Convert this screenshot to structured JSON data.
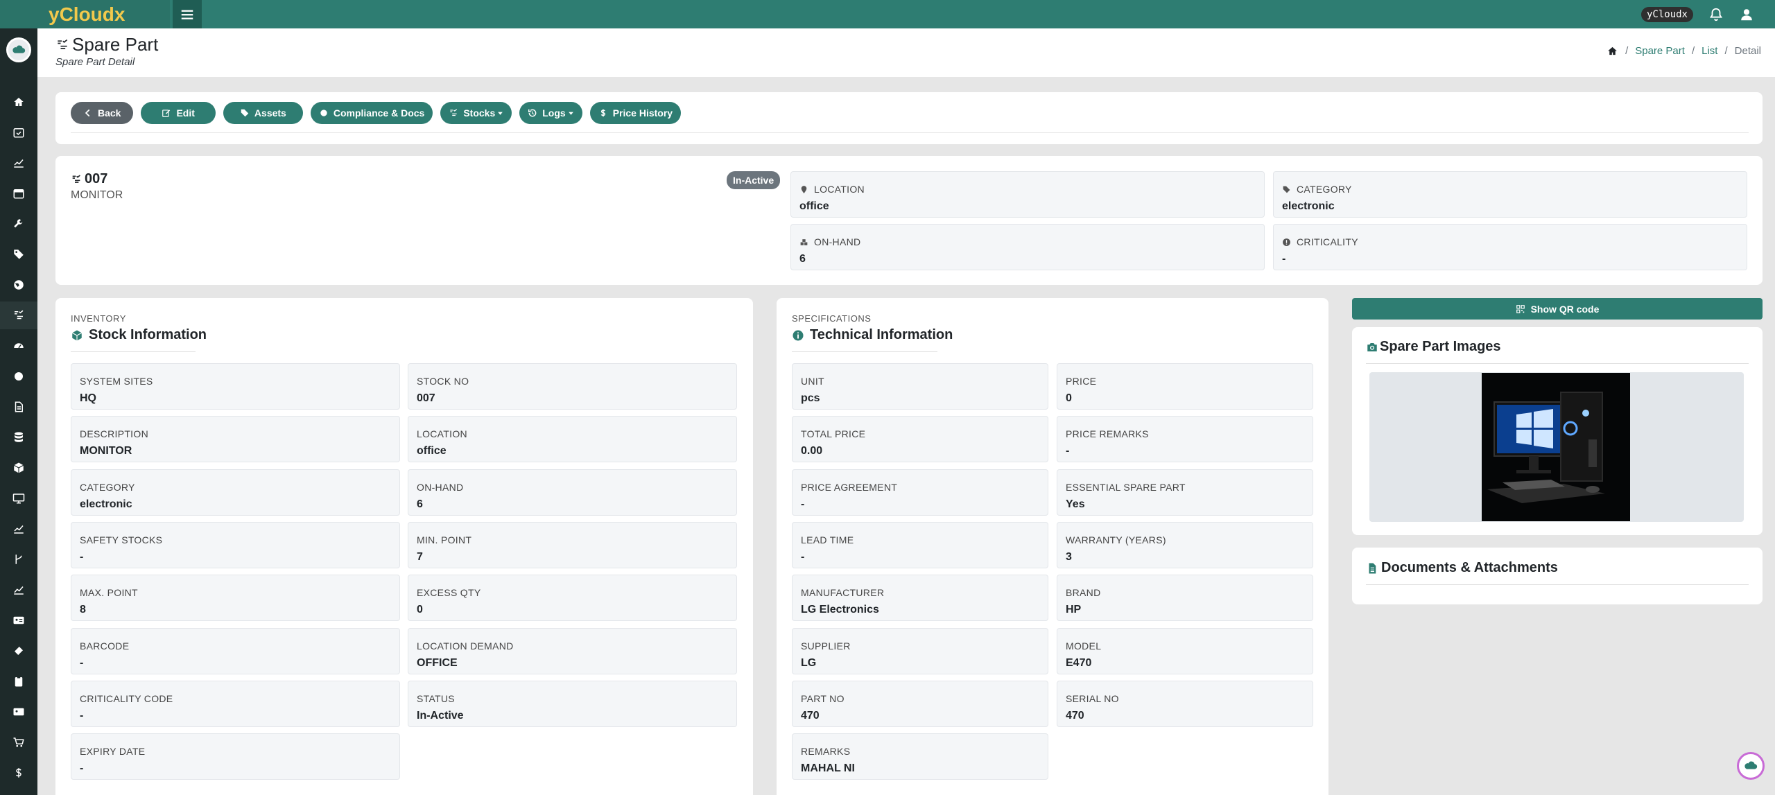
{
  "app": {
    "brand": "yCloudx",
    "user_chip": "yCloudx"
  },
  "sidebar": {
    "items": [
      {
        "icon": "home-icon"
      },
      {
        "icon": "calendar-check-icon"
      },
      {
        "icon": "chart-line-icon"
      },
      {
        "icon": "calendar-icon"
      },
      {
        "icon": "wrench-icon"
      },
      {
        "icon": "tag-icon"
      },
      {
        "icon": "globe-icon"
      },
      {
        "icon": "spare-part-icon"
      },
      {
        "icon": "dashboard-icon"
      },
      {
        "icon": "circle-icon"
      },
      {
        "icon": "document-icon"
      },
      {
        "icon": "database-icon"
      },
      {
        "icon": "box-icon"
      },
      {
        "icon": "monitor-icon"
      },
      {
        "icon": "chart-line-icon"
      },
      {
        "icon": "branch-icon"
      },
      {
        "icon": "chart-area-icon"
      },
      {
        "icon": "id-card-icon"
      },
      {
        "icon": "ticket-icon"
      },
      {
        "icon": "clipboard-icon"
      },
      {
        "icon": "contact-card-icon"
      },
      {
        "icon": "cart-icon"
      },
      {
        "icon": "dollar-icon"
      }
    ]
  },
  "header": {
    "title": "Spare Part",
    "subtitle": "Spare Part Detail",
    "breadcrumb": [
      "Spare Part",
      "List",
      "Detail"
    ]
  },
  "actions": {
    "back": "Back",
    "edit": "Edit",
    "assets": "Assets",
    "compliance": "Compliance & Docs",
    "stocks": "Stocks",
    "logs": "Logs",
    "price_history": "Price History"
  },
  "summary": {
    "id": "007",
    "description": "MONITOR",
    "status": "In-Active",
    "fields": {
      "location": {
        "label": "LOCATION",
        "value": "office"
      },
      "category": {
        "label": "CATEGORY",
        "value": "electronic"
      },
      "on_hand": {
        "label": "ON-HAND",
        "value": "6"
      },
      "criticality": {
        "label": "CRITICALITY",
        "value": "-"
      }
    }
  },
  "inventory": {
    "overline": "INVENTORY",
    "title": "Stock Information",
    "fields": [
      {
        "label": "SYSTEM SITES",
        "value": "HQ"
      },
      {
        "label": "STOCK NO",
        "value": "007"
      },
      {
        "label": "DESCRIPTION",
        "value": "MONITOR"
      },
      {
        "label": "LOCATION",
        "value": "office"
      },
      {
        "label": "CATEGORY",
        "value": "electronic"
      },
      {
        "label": "ON-HAND",
        "value": "6"
      },
      {
        "label": "SAFETY STOCKS",
        "value": "-"
      },
      {
        "label": "MIN. POINT",
        "value": "7"
      },
      {
        "label": "MAX. POINT",
        "value": "8"
      },
      {
        "label": "EXCESS QTY",
        "value": "0"
      },
      {
        "label": "BARCODE",
        "value": "-"
      },
      {
        "label": "LOCATION DEMAND",
        "value": "OFFICE"
      },
      {
        "label": "CRITICALITY CODE",
        "value": "-"
      },
      {
        "label": "STATUS",
        "value": "In-Active"
      },
      {
        "label": "EXPIRY DATE",
        "value": "-"
      }
    ]
  },
  "technical": {
    "overline": "SPECIFICATIONS",
    "title": "Technical Information",
    "fields": [
      {
        "label": "UNIT",
        "value": "pcs"
      },
      {
        "label": "PRICE",
        "value": "0"
      },
      {
        "label": "TOTAL PRICE",
        "value": "0.00"
      },
      {
        "label": "PRICE REMARKS",
        "value": "-"
      },
      {
        "label": "PRICE AGREEMENT",
        "value": "-"
      },
      {
        "label": "ESSENTIAL SPARE PART",
        "value": "Yes"
      },
      {
        "label": "LEAD TIME",
        "value": "-"
      },
      {
        "label": "WARRANTY (YEARS)",
        "value": "3"
      },
      {
        "label": "MANUFACTURER",
        "value": "LG Electronics"
      },
      {
        "label": "BRAND",
        "value": "HP"
      },
      {
        "label": "SUPPLIER",
        "value": "LG"
      },
      {
        "label": "MODEL",
        "value": "E470"
      },
      {
        "label": "PART NO",
        "value": "470"
      },
      {
        "label": "SERIAL NO",
        "value": "470"
      },
      {
        "label": "REMARKS",
        "value": "MAHAL NI"
      }
    ]
  },
  "side": {
    "qr_label": "Show QR code",
    "images_title": "Spare Part Images",
    "docs_title": "Documents & Attachments"
  },
  "colors": {
    "primary": "#2e7d72",
    "brand_text": "#f2c94c",
    "sidebar": "#1e2a2a",
    "badge": "#6c757d"
  }
}
